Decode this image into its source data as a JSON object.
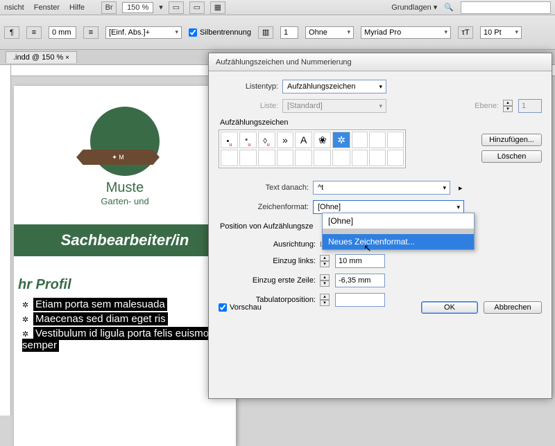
{
  "menu": {
    "ansicht": "nsicht",
    "fenster": "Fenster",
    "hilfe": "Hilfe",
    "br": "Br",
    "zoom": "150 %",
    "workspace": "Grundlagen"
  },
  "optbar": {
    "mm0": "0 mm",
    "parastyle": "[Einf. Abs.]+",
    "hyphen": "Silbentrennung",
    "cols": "1",
    "none": "Ohne",
    "font": "Myriad Pro",
    "size": "10 Pt"
  },
  "doctab": ".indd @ 150 %",
  "doc": {
    "company": "Muste",
    "tagline": "Garten- und ",
    "ribbon": "✦ M",
    "job": "Sachbearbeiter/in",
    "section": "hr Profil",
    "bullets": [
      "Etiam porta sem malesuada",
      "Maecenas sed diam eget ris",
      "Vestibulum id ligula porta felis euismod semper"
    ]
  },
  "dlg": {
    "title": "Aufzählungszeichen und Nummerierung",
    "listentyp_lbl": "Listentyp:",
    "listentyp_val": "Aufzählungszeichen",
    "liste_lbl": "Liste:",
    "liste_val": "[Standard]",
    "ebene_lbl": "Ebene:",
    "ebene_val": "1",
    "bullets_lbl": "Aufzählungszeichen",
    "glyphs": [
      "•",
      "*",
      "◊",
      "»",
      "A",
      "❀",
      "✲"
    ],
    "add": "Hinzufügen...",
    "del": "Löschen",
    "text_danach_lbl": "Text danach:",
    "text_danach_val": "^t",
    "zeichenformat_lbl": "Zeichenformat:",
    "zeichenformat_val": "[Ohne]",
    "dropdown": {
      "opt1": "[Ohne]",
      "opt2": "Neues Zeichenformat..."
    },
    "position_lbl": "Position von Aufzählungsze",
    "ausrichtung_lbl": "Ausrichtung:",
    "ausrichtung_val": "Links",
    "einzug_links_lbl": "Einzug links:",
    "einzug_links_val": "10 mm",
    "einzug_erste_lbl": "Einzug erste Zeile:",
    "einzug_erste_val": "-6,35 mm",
    "tab_lbl": "Tabulatorposition:",
    "tab_val": "",
    "vorschau": "Vorschau",
    "ok": "OK",
    "cancel": "Abbrechen"
  }
}
